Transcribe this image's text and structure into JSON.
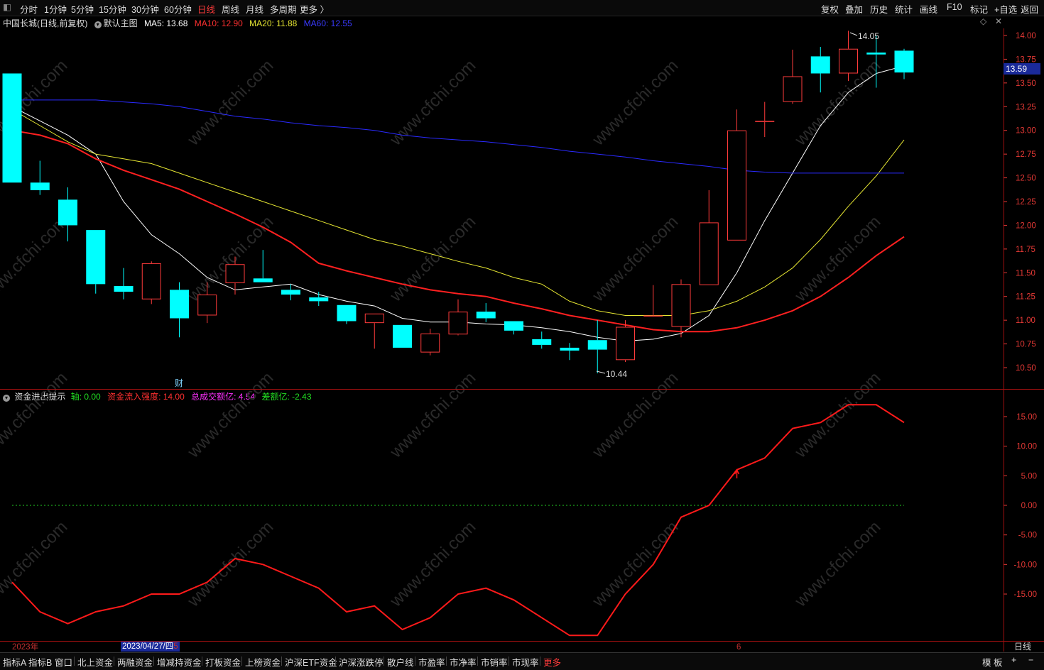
{
  "toolbar": {
    "left_items": [
      "分时",
      "1分钟",
      "5分钟",
      "15分钟",
      "30分钟",
      "60分钟",
      "日线",
      "周线",
      "月线",
      "多周期",
      "更多 〉"
    ],
    "active_item": "日线",
    "right_items": [
      "复权",
      "叠加",
      "历史",
      "统计",
      "画线",
      "F10",
      "标记",
      "+自选",
      "返回"
    ]
  },
  "main_info": {
    "stock": "中国长城(日线,前复权)",
    "template": "默认主图",
    "ma5_label": "MA5: 13.68",
    "ma10_label": "MA10: 12.90",
    "ma20_label": "MA20: 11.88",
    "ma60_label": "MA60: 12.55"
  },
  "sub_info": {
    "title": "资金进出提示",
    "axis_label": "轴: 0.00",
    "strength_label": "资金流入强度: 14.00",
    "volume_label": "总成交额亿: 4.54",
    "diff_label": "差额亿: -2.43"
  },
  "colors": {
    "up": "#ff3b3b",
    "down": "#00ffff",
    "ma5": "#ffffff",
    "ma10": "#ff2020",
    "ma20": "#e6e632",
    "ma60": "#2a2aff",
    "axis": "#e53935",
    "panel_border": "#a01010"
  },
  "current_price_tag": "13.59",
  "max_label": "14.05",
  "min_label": "10.44",
  "cai_marker": "财",
  "bottom_axis": {
    "year_label": "2023年",
    "cursor_date": "2023/04/27/四",
    "month_5_label": "5",
    "month_6_label": "6",
    "period_label": "日线"
  },
  "bottom_tabs": [
    "指标A",
    "指标B",
    "窗口",
    "北上资金",
    "两融资金",
    "增减持资金",
    "打板资金",
    "上榜资金",
    "沪深ETF资金",
    "沪深涨跌停",
    "散户线",
    "市盈率",
    "市净率",
    "市销率",
    "市现率",
    "更多"
  ],
  "bottom_right": [
    "模 板",
    "+",
    "−"
  ],
  "watermark": "www.cfchi.com",
  "chart_data": [
    {
      "type": "candlestick",
      "title": "中国长城(日线,前复权)",
      "ylim": [
        10.3,
        14.1
      ],
      "yticks": [
        10.5,
        10.75,
        11.0,
        11.25,
        11.5,
        11.75,
        12.0,
        12.25,
        12.5,
        12.75,
        13.0,
        13.25,
        13.5,
        13.75,
        14.0
      ],
      "candles": [
        {
          "o": 13.6,
          "h": 13.6,
          "l": 12.45,
          "c": 12.45
        },
        {
          "o": 12.45,
          "h": 12.68,
          "l": 12.32,
          "c": 12.37
        },
        {
          "o": 12.27,
          "h": 12.4,
          "l": 11.83,
          "c": 12.0
        },
        {
          "o": 11.95,
          "h": 11.95,
          "l": 11.28,
          "c": 11.38
        },
        {
          "o": 11.36,
          "h": 11.55,
          "l": 11.22,
          "c": 11.3
        },
        {
          "o": 11.22,
          "h": 11.62,
          "l": 11.17,
          "c": 11.6
        },
        {
          "o": 11.32,
          "h": 11.4,
          "l": 10.82,
          "c": 11.02
        },
        {
          "o": 11.05,
          "h": 11.4,
          "l": 10.97,
          "c": 11.27
        },
        {
          "o": 11.39,
          "h": 11.67,
          "l": 11.27,
          "c": 11.59
        },
        {
          "o": 11.44,
          "h": 11.74,
          "l": 11.4,
          "c": 11.4
        },
        {
          "o": 11.32,
          "h": 11.38,
          "l": 11.21,
          "c": 11.27
        },
        {
          "o": 11.24,
          "h": 11.3,
          "l": 11.15,
          "c": 11.2
        },
        {
          "o": 11.16,
          "h": 11.16,
          "l": 10.96,
          "c": 10.99
        },
        {
          "o": 10.97,
          "h": 11.07,
          "l": 10.7,
          "c": 11.07
        },
        {
          "o": 10.95,
          "h": 10.95,
          "l": 10.71,
          "c": 10.71
        },
        {
          "o": 10.66,
          "h": 10.91,
          "l": 10.63,
          "c": 10.86
        },
        {
          "o": 10.85,
          "h": 11.22,
          "l": 10.84,
          "c": 11.09
        },
        {
          "o": 11.09,
          "h": 11.18,
          "l": 10.98,
          "c": 11.02
        },
        {
          "o": 10.99,
          "h": 10.99,
          "l": 10.85,
          "c": 10.89
        },
        {
          "o": 10.8,
          "h": 10.88,
          "l": 10.7,
          "c": 10.74
        },
        {
          "o": 10.71,
          "h": 10.76,
          "l": 10.58,
          "c": 10.68
        },
        {
          "o": 10.79,
          "h": 11.0,
          "l": 10.44,
          "c": 10.69
        },
        {
          "o": 10.58,
          "h": 11.0,
          "l": 10.56,
          "c": 10.93
        },
        {
          "o": 11.05,
          "h": 11.37,
          "l": 11.05,
          "c": 11.05
        },
        {
          "o": 10.93,
          "h": 11.43,
          "l": 10.82,
          "c": 11.38
        },
        {
          "o": 11.37,
          "h": 12.37,
          "l": 11.37,
          "c": 12.03
        },
        {
          "o": 11.84,
          "h": 13.22,
          "l": 11.84,
          "c": 13.0
        },
        {
          "o": 13.1,
          "h": 13.3,
          "l": 12.93,
          "c": 13.1
        },
        {
          "o": 13.3,
          "h": 13.85,
          "l": 13.28,
          "c": 13.57
        },
        {
          "o": 13.78,
          "h": 13.88,
          "l": 13.4,
          "c": 13.6
        },
        {
          "o": 13.6,
          "h": 14.05,
          "l": 13.52,
          "c": 13.86
        },
        {
          "o": 13.82,
          "h": 14.0,
          "l": 13.45,
          "c": 13.8
        },
        {
          "o": 13.84,
          "h": 13.86,
          "l": 13.54,
          "c": 13.61
        }
      ],
      "series": [
        {
          "name": "MA5",
          "values": [
            13.25,
            13.1,
            12.95,
            12.75,
            12.25,
            11.9,
            11.7,
            11.45,
            11.32,
            11.35,
            11.38,
            11.27,
            11.2,
            11.15,
            11.02,
            10.98,
            10.98,
            10.96,
            10.95,
            10.92,
            10.88,
            10.82,
            10.78,
            10.8,
            10.86,
            11.05,
            11.5,
            12.05,
            12.55,
            13.05,
            13.4,
            13.6,
            13.68
          ]
        },
        {
          "name": "MA10",
          "values": [
            13.0,
            12.95,
            12.86,
            12.7,
            12.58,
            12.48,
            12.38,
            12.25,
            12.12,
            11.98,
            11.82,
            11.6,
            11.52,
            11.45,
            11.38,
            11.32,
            11.28,
            11.25,
            11.18,
            11.12,
            11.05,
            11.0,
            10.95,
            10.9,
            10.88,
            10.88,
            10.92,
            11.0,
            11.1,
            11.25,
            11.45,
            11.68,
            11.88
          ]
        },
        {
          "name": "MA20",
          "values": [
            13.22,
            13.05,
            12.88,
            12.75,
            12.7,
            12.65,
            12.55,
            12.45,
            12.35,
            12.25,
            12.15,
            12.05,
            11.95,
            11.85,
            11.78,
            11.7,
            11.62,
            11.55,
            11.45,
            11.38,
            11.2,
            11.1,
            11.05,
            11.05,
            11.05,
            11.1,
            11.2,
            11.35,
            11.55,
            11.85,
            12.2,
            12.52,
            12.9
          ]
        },
        {
          "name": "MA60",
          "values": [
            13.32,
            13.32,
            13.32,
            13.32,
            13.3,
            13.28,
            13.25,
            13.2,
            13.15,
            13.12,
            13.08,
            13.05,
            13.03,
            13.0,
            12.95,
            12.92,
            12.9,
            12.88,
            12.85,
            12.82,
            12.78,
            12.75,
            12.72,
            12.68,
            12.65,
            12.62,
            12.58,
            12.56,
            12.55,
            12.55,
            12.55,
            12.55,
            12.55
          ]
        }
      ]
    },
    {
      "type": "line",
      "title": "资金进出提示",
      "ylim": [
        -18.5,
        17
      ],
      "yticks": [
        15.0,
        10.0,
        5.0,
        0.0,
        -5.0,
        -10.0,
        -15.0
      ],
      "series": [
        {
          "name": "资金流入强度",
          "values": [
            -13,
            -18,
            -20,
            -18,
            -17,
            -15,
            -15,
            -13,
            -9,
            -10,
            -12,
            -14,
            -18,
            -17,
            -21,
            -19,
            -15,
            -14,
            -16,
            -19,
            -22,
            -22,
            -15,
            -10,
            -2,
            0,
            6,
            8,
            13,
            14,
            17,
            17,
            14
          ]
        },
        {
          "name": "轴",
          "values": [
            0,
            0,
            0,
            0,
            0,
            0,
            0,
            0,
            0,
            0,
            0,
            0,
            0,
            0,
            0,
            0,
            0,
            0,
            0,
            0,
            0,
            0,
            0,
            0,
            0,
            0,
            0,
            0,
            0,
            0,
            0,
            0,
            0
          ]
        }
      ]
    }
  ]
}
